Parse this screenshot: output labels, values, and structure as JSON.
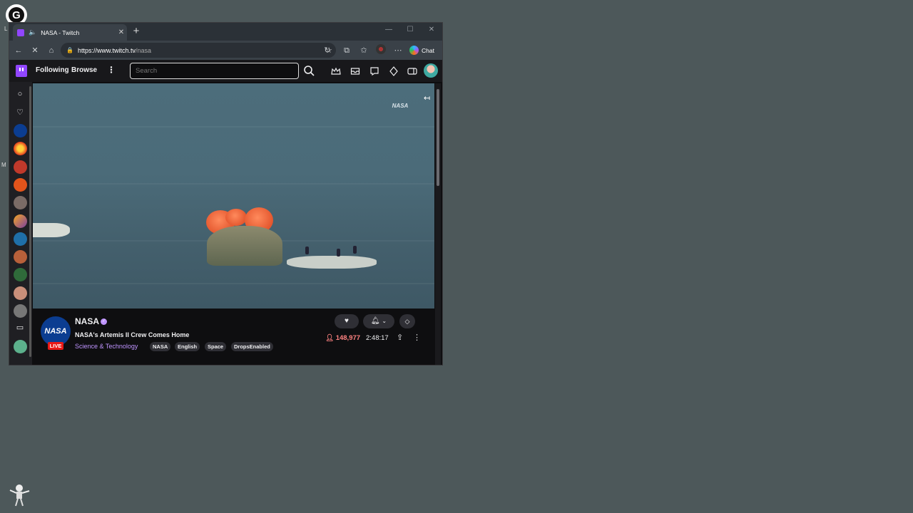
{
  "browser": {
    "tab_title": "NASA - Twitch",
    "url_host": "https://www.twitch.tv",
    "url_path": "/nasa",
    "chat_label": "Chat",
    "new_tab_symbol": "+"
  },
  "twitch": {
    "nav": {
      "following": "Following",
      "browse": "Browse",
      "search_placeholder": "Search"
    },
    "player": {
      "watermark": "NASA"
    },
    "channel": {
      "name": "NASA",
      "avatar_text": "NASA",
      "live_label": "LIVE",
      "stream_title": "NASA's Artemis II Crew Comes Home",
      "category": "Science & Technology",
      "tags": [
        "NASA",
        "English",
        "Space",
        "DropsEnabled"
      ],
      "viewers": "148,977",
      "uptime": "2:48:17"
    }
  },
  "colors": {
    "twitch_purple": "#9146ff",
    "live_red": "#e91916",
    "viewer_red": "#ff8280",
    "category_purple": "#bf94ff"
  }
}
